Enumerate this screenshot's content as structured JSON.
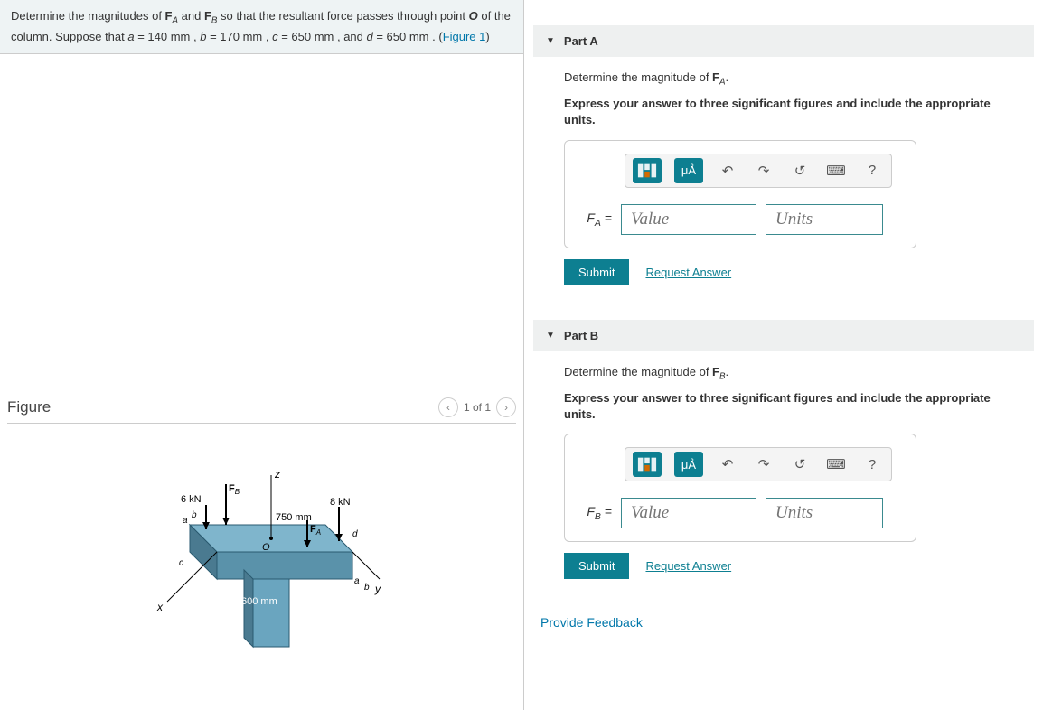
{
  "problem": {
    "prefix": "Determine the magnitudes of ",
    "f_a": "F",
    "f_a_sub": "A",
    "and": " and ",
    "f_b": "F",
    "f_b_sub": "B",
    "mid": " so that the resultant force passes through point ",
    "o": "O",
    "mid2": " of the column. Suppose that ",
    "a_var": "a",
    "a_val": " = 140  mm , ",
    "b_var": "b",
    "b_val": " = 170  mm , ",
    "c_var": "c",
    "c_val": " = 650  mm , and ",
    "d_var": "d",
    "d_val": " = 650  mm . (",
    "fig_link": "Figure 1",
    "end": ")"
  },
  "figure": {
    "title": "Figure",
    "pager": "1 of 1",
    "labels": {
      "z": "z",
      "x": "x",
      "y": "y",
      "fb": "F",
      "fb_sub": "B",
      "fa": "F",
      "fa_sub": "A",
      "six_kn": "6 kN",
      "eight_kn": "8 kN",
      "seven_fifty": "750 mm",
      "six_hundred": "600 mm",
      "o": "O",
      "a": "a",
      "b": "b",
      "c": "c",
      "d": "d"
    }
  },
  "partA": {
    "title": "Part A",
    "prompt_pre": "Determine the magnitude of ",
    "prompt_f": "F",
    "prompt_sub": "A",
    "prompt_end": ".",
    "instruction": "Express your answer to three significant figures and include the appropriate units.",
    "var": "F",
    "var_sub": "A",
    "equals": " = ",
    "value_ph": "Value",
    "units_ph": "Units",
    "mu_a": "μÅ"
  },
  "partB": {
    "title": "Part B",
    "prompt_pre": "Determine the magnitude of ",
    "prompt_f": "F",
    "prompt_sub": "B",
    "prompt_end": ".",
    "instruction": "Express your answer to three significant figures and include the appropriate units.",
    "var": "F",
    "var_sub": "B",
    "equals": " = ",
    "value_ph": "Value",
    "units_ph": "Units",
    "mu_a": "μÅ"
  },
  "buttons": {
    "submit": "Submit",
    "request": "Request Answer",
    "feedback": "Provide Feedback",
    "help": "?"
  }
}
